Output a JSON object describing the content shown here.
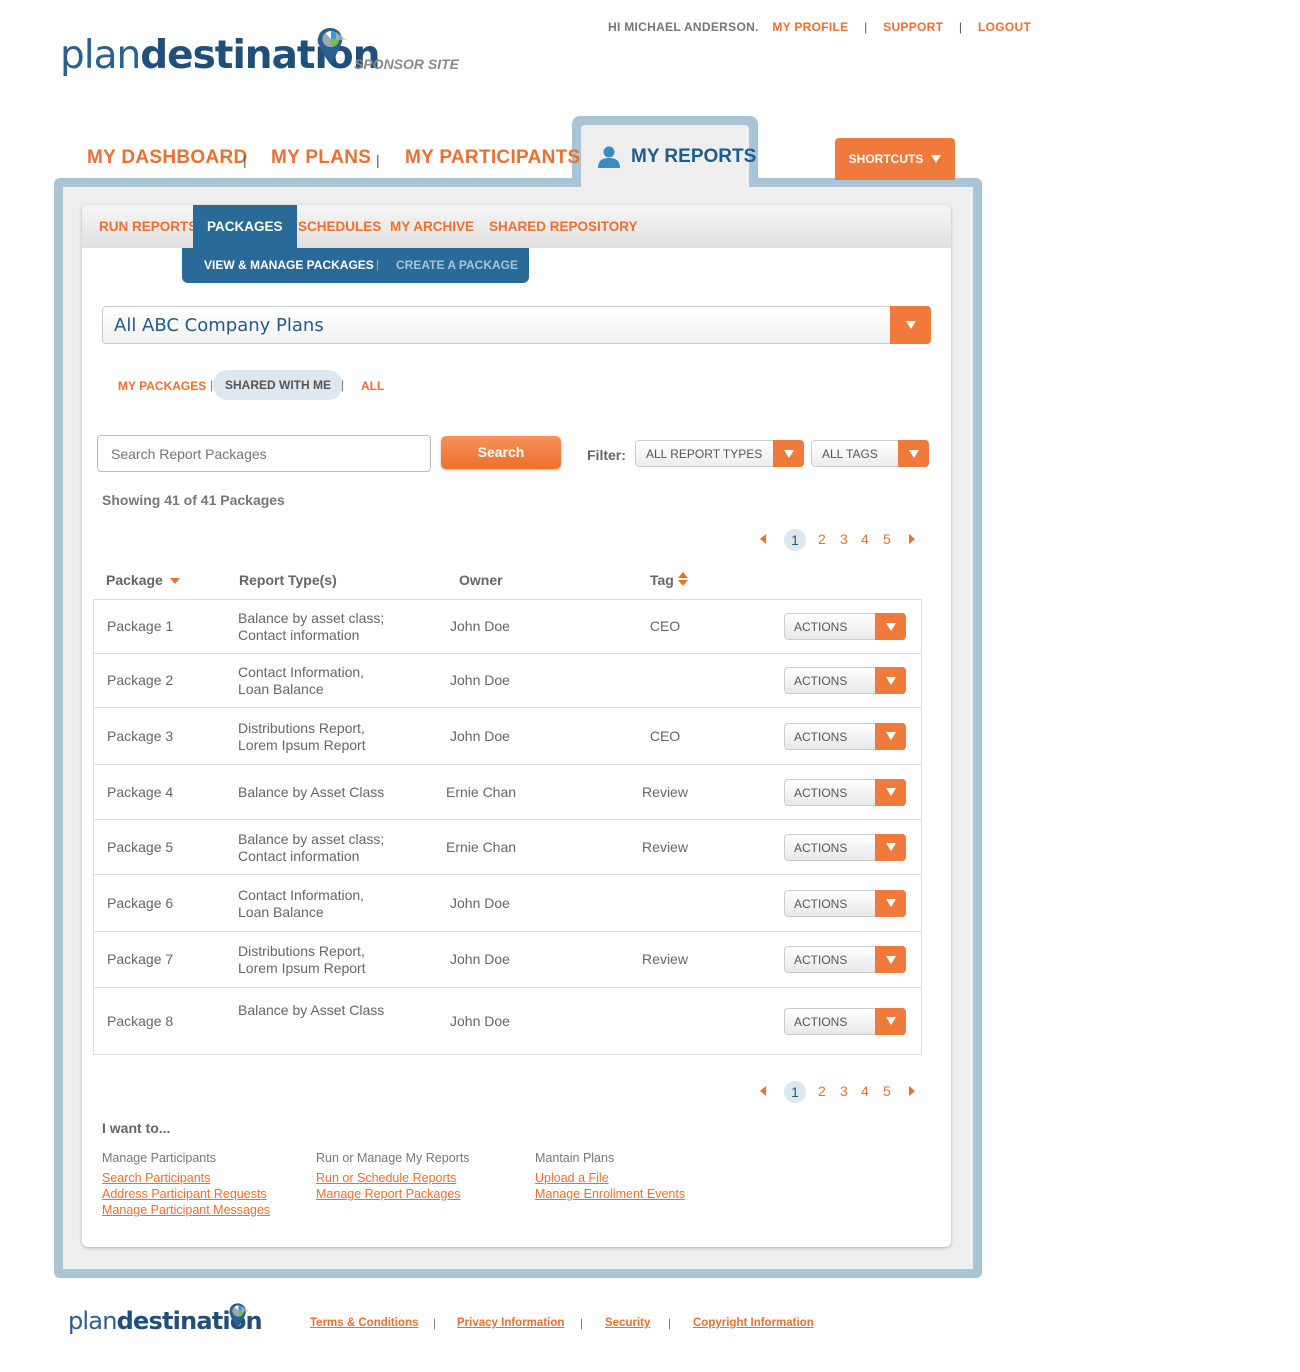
{
  "header": {
    "logo_plan": "plan",
    "logo_destination": "destination",
    "logo_subtitle": "SPONSOR SITE",
    "greeting": "HI MICHAEL ANDERSON.",
    "links": [
      "MY PROFILE",
      "SUPPORT",
      "LOGOUT"
    ]
  },
  "main_nav": {
    "tabs": [
      "MY DASHBOARD",
      "MY PLANS",
      "MY PARTICIPANTS",
      "MY REPORTS"
    ],
    "active": "MY REPORTS",
    "separator": "|",
    "shortcuts": "SHORTCUTS"
  },
  "sub_nav": {
    "tabs": [
      "RUN REPORTS",
      "PACKAGES",
      "SCHEDULES",
      "MY ARCHIVE",
      "SHARED REPOSITORY"
    ],
    "active": "PACKAGES",
    "sub_tabs": [
      "VIEW & MANAGE PACKAGES",
      "CREATE A PACKAGE"
    ],
    "sub_active": "VIEW & MANAGE PACKAGES"
  },
  "plan_select": {
    "value": "All ABC Company Plans"
  },
  "package_filter": {
    "options": [
      "MY PACKAGES",
      "SHARED WITH ME",
      "ALL"
    ],
    "active": "SHARED WITH ME"
  },
  "search": {
    "placeholder": "Search Report Packages",
    "button": "Search",
    "filter_label": "Filter:",
    "report_type": "ALL REPORT TYPES",
    "tags": "ALL TAGS"
  },
  "showing": "Showing 41 of 41 Packages",
  "pagination": {
    "pages": [
      "1",
      "2",
      "3",
      "4",
      "5"
    ],
    "current": "1"
  },
  "table": {
    "columns": [
      "Package",
      "Report Type(s)",
      "Owner",
      "Tag"
    ],
    "action_label": "ACTIONS",
    "rows": [
      {
        "package": "Package 1",
        "types": [
          "Balance by asset class;",
          "Contact information"
        ],
        "owner": "John Doe",
        "tag": "CEO"
      },
      {
        "package": "Package 2",
        "types": [
          "Contact Information,",
          "Loan Balance"
        ],
        "owner": "John Doe",
        "tag": ""
      },
      {
        "package": "Package 3",
        "types": [
          "Distributions Report,",
          "Lorem Ipsum Report"
        ],
        "owner": "John Doe",
        "tag": "CEO"
      },
      {
        "package": "Package 4",
        "types": [
          "Balance by Asset Class"
        ],
        "owner": "Ernie Chan",
        "tag": "Review"
      },
      {
        "package": "Package 5",
        "types": [
          "Balance by asset class;",
          "Contact information"
        ],
        "owner": "Ernie Chan",
        "tag": "Review"
      },
      {
        "package": "Package 6",
        "types": [
          "Contact Information,",
          "Loan Balance"
        ],
        "owner": "John Doe",
        "tag": ""
      },
      {
        "package": "Package 7",
        "types": [
          "Distributions Report,",
          "Lorem Ipsum Report"
        ],
        "owner": "John Doe",
        "tag": "Review"
      },
      {
        "package": "Package 8",
        "types": [
          "Balance by Asset Class"
        ],
        "owner": "John Doe",
        "tag": ""
      }
    ]
  },
  "i_want_to": {
    "title": "I want to...",
    "groups": [
      {
        "heading": "Manage Participants",
        "links": [
          "Search Participants",
          "Address Participant Requests",
          "Manage Participant Messages"
        ]
      },
      {
        "heading": "Run or Manage My Reports",
        "links": [
          "Run or Schedule Reports",
          "Manage Report Packages"
        ]
      },
      {
        "heading": "Mantain Plans",
        "links": [
          "Upload a File",
          "Manage Enrollment Events"
        ]
      }
    ]
  },
  "footer": {
    "links": [
      "Terms & Conditions",
      "Privacy Information",
      "Security",
      "Copyright Information"
    ]
  },
  "colors": {
    "accent": "#ee6f2d",
    "brand_blue": "#1f5c88",
    "frame": "#a9c4d6",
    "active_tab": "#2a6a98"
  }
}
